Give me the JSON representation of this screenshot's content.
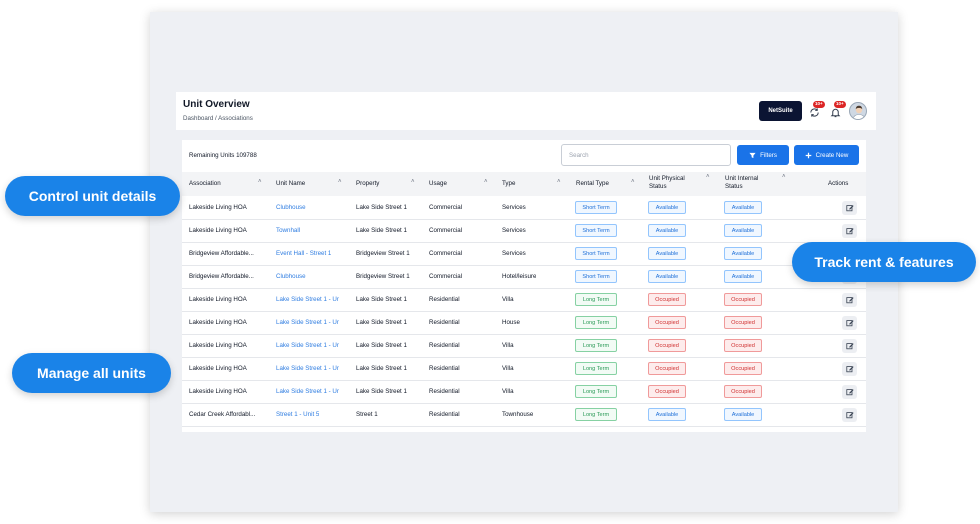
{
  "page": {
    "title": "Unit Overview",
    "breadcrumb": "Dashboard / Associations"
  },
  "header": {
    "netsuite_label": "NetSuite",
    "badges": [
      "10+",
      "10+"
    ]
  },
  "toolbar": {
    "remaining": "Remaining Units 109788",
    "search_placeholder": "Search",
    "filters_label": "Filters",
    "create_label": "Create New"
  },
  "table": {
    "columns": [
      "Association",
      "Unit Name",
      "Property",
      "Usage",
      "Type",
      "Rental Type",
      "Unit Physical Status",
      "Unit Internal Status",
      "Actions"
    ],
    "rows": [
      {
        "association": "Lakeside Living HOA",
        "unit": "Clubhouse",
        "property": "Lake Side Street 1",
        "usage": "Commercial",
        "type": "Services",
        "rental": "Short Term",
        "physical": "Available",
        "internal": "Available"
      },
      {
        "association": "Lakeside Living HOA",
        "unit": "Townhall",
        "property": "Lake Side Street 1",
        "usage": "Commercial",
        "type": "Services",
        "rental": "Short Term",
        "physical": "Available",
        "internal": "Available"
      },
      {
        "association": "Bridgeview Affordable...",
        "unit": "Event Hall - Street 1",
        "property": "Bridgeview Street 1",
        "usage": "Commercial",
        "type": "Services",
        "rental": "Short Term",
        "physical": "Available",
        "internal": "Available"
      },
      {
        "association": "Bridgeview Affordable...",
        "unit": "Clubhouse",
        "property": "Bridgeview Street 1",
        "usage": "Commercial",
        "type": "Hotel/leisure",
        "rental": "Short Term",
        "physical": "Available",
        "internal": "Available"
      },
      {
        "association": "Lakeside Living HOA",
        "unit": "Lake Side Street 1 - Ur",
        "property": "Lake Side Street 1",
        "usage": "Residential",
        "type": "Villa",
        "rental": "Long Term",
        "physical": "Occupied",
        "internal": "Occupied"
      },
      {
        "association": "Lakeside Living HOA",
        "unit": "Lake Side Street 1 - Ur",
        "property": "Lake Side Street 1",
        "usage": "Residential",
        "type": "House",
        "rental": "Long Term",
        "physical": "Occupied",
        "internal": "Occupied"
      },
      {
        "association": "Lakeside Living HOA",
        "unit": "Lake Side Street 1 - Ur",
        "property": "Lake Side Street 1",
        "usage": "Residential",
        "type": "Villa",
        "rental": "Long Term",
        "physical": "Occupied",
        "internal": "Occupied"
      },
      {
        "association": "Lakeside Living HOA",
        "unit": "Lake Side Street 1 - Ur",
        "property": "Lake Side Street 1",
        "usage": "Residential",
        "type": "Villa",
        "rental": "Long Term",
        "physical": "Occupied",
        "internal": "Occupied"
      },
      {
        "association": "Lakeside Living HOA",
        "unit": "Lake Side Street 1 - Ur",
        "property": "Lake Side Street 1",
        "usage": "Residential",
        "type": "Villa",
        "rental": "Long Term",
        "physical": "Occupied",
        "internal": "Occupied"
      },
      {
        "association": "Cedar Creek Affordabl...",
        "unit": "Street 1 - Unit 5",
        "property": "Street 1",
        "usage": "Residential",
        "type": "Townhouse",
        "rental": "Long Term",
        "physical": "Available",
        "internal": "Available"
      }
    ]
  },
  "callouts": {
    "control": "Control unit details",
    "track": "Track rent & features",
    "manage": "Manage all units"
  },
  "colors": {
    "accent": "#1a73e8",
    "callout": "#1a83e8",
    "dark": "#0b1433"
  }
}
